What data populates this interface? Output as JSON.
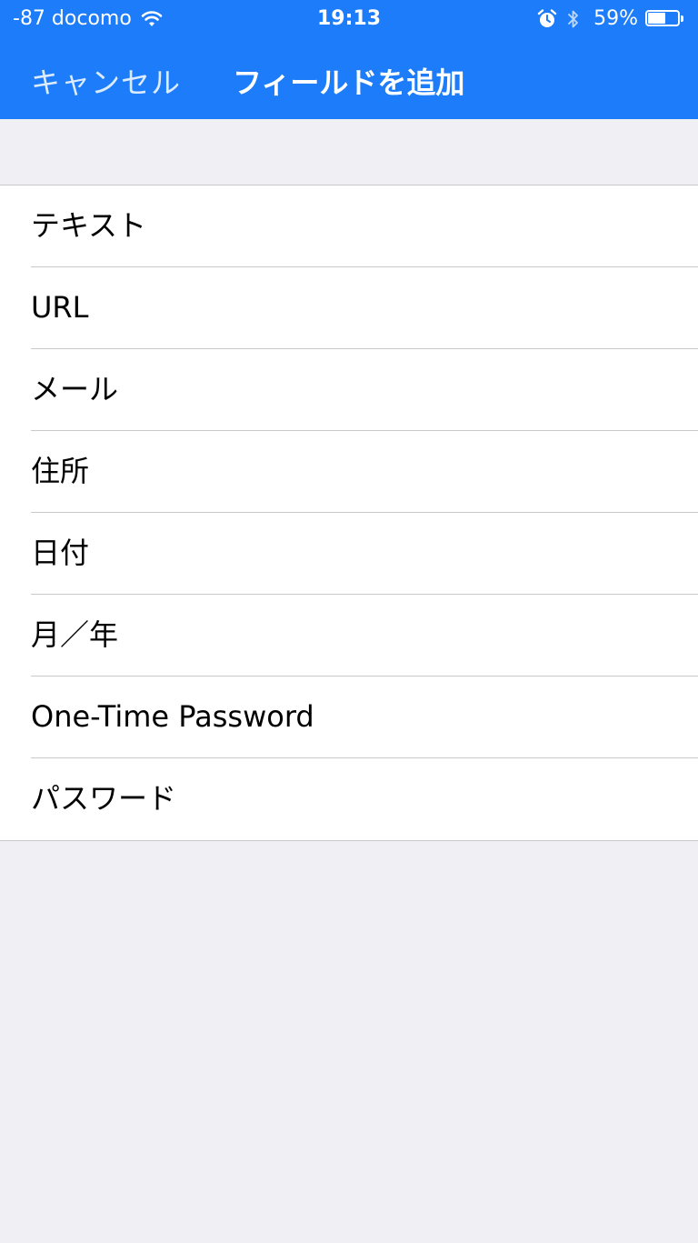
{
  "status_bar": {
    "carrier": "-87 docomo",
    "time": "19:13",
    "battery_percent_label": "59%",
    "battery_level": 0.59
  },
  "nav": {
    "cancel_label": "キャンセル",
    "title": "フィールドを追加"
  },
  "field_types": [
    {
      "label": "テキスト"
    },
    {
      "label": "URL"
    },
    {
      "label": "メール"
    },
    {
      "label": "住所"
    },
    {
      "label": "日付"
    },
    {
      "label": "月／年"
    },
    {
      "label": "One-Time Password"
    },
    {
      "label": "パスワード"
    }
  ],
  "colors": {
    "nav_background": "#1c7cf9",
    "page_background": "#efeff4",
    "separator": "#c8c7cc"
  }
}
